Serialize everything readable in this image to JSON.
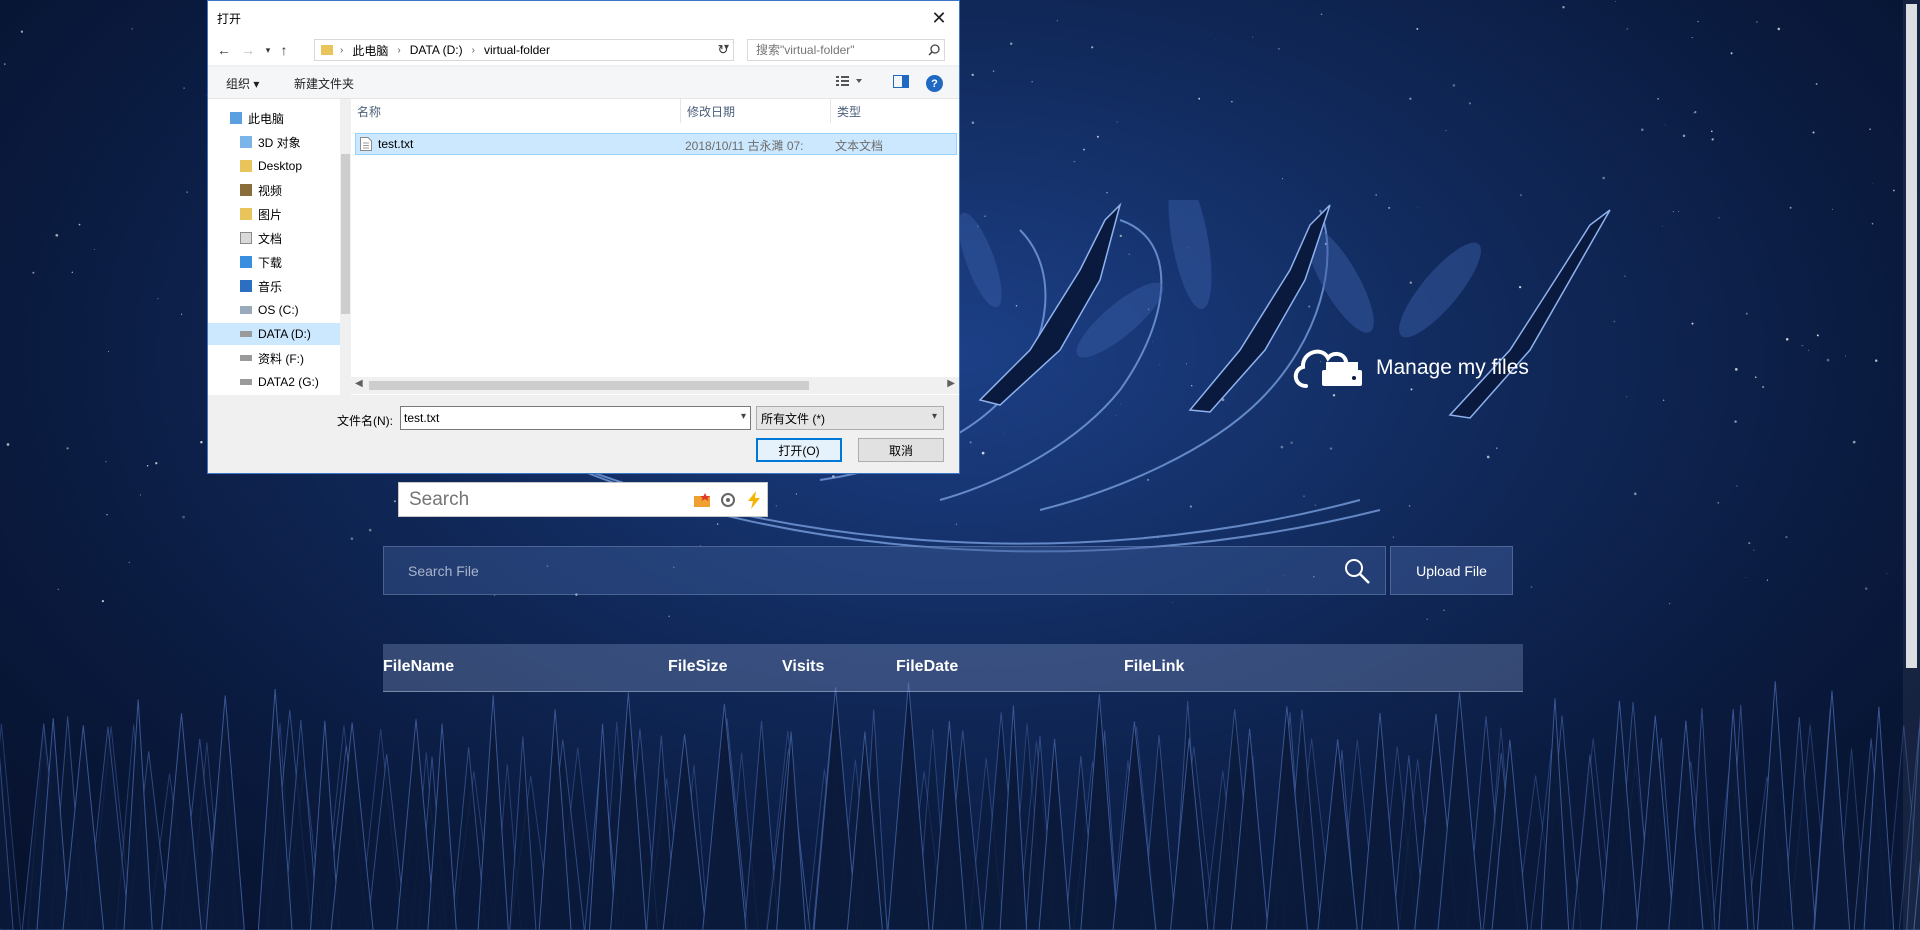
{
  "dialog": {
    "title": "打开",
    "close_glyph": "✕",
    "address": {
      "segments": [
        "此电脑",
        "DATA (D:)",
        "virtual-folder"
      ]
    },
    "search_placeholder": "搜索\"virtual-folder\"",
    "toolbar": {
      "organize": "组织 ▾",
      "new_folder": "新建文件夹",
      "help": "?"
    },
    "nav": {
      "items": [
        {
          "label": "此电脑",
          "icon": "computer-icon"
        },
        {
          "label": "3D 对象",
          "icon": "3d-objects-icon"
        },
        {
          "label": "Desktop",
          "icon": "desktop-folder-icon"
        },
        {
          "label": "视频",
          "icon": "videos-icon"
        },
        {
          "label": "图片",
          "icon": "pictures-icon"
        },
        {
          "label": "文档",
          "icon": "documents-icon"
        },
        {
          "label": "下载",
          "icon": "downloads-icon"
        },
        {
          "label": "音乐",
          "icon": "music-icon"
        },
        {
          "label": "OS (C:)",
          "icon": "os-drive-icon"
        },
        {
          "label": "DATA (D:)",
          "icon": "drive-icon"
        },
        {
          "label": "资料 (F:)",
          "icon": "drive-icon"
        },
        {
          "label": "DATA2 (G:)",
          "icon": "drive-icon"
        }
      ],
      "selected_index": 9
    },
    "columns": [
      "名称",
      "修改日期",
      "类型"
    ],
    "files": [
      {
        "name": "test.txt",
        "modified": "2018/10/11 古永濉 07:",
        "type": "文本文档"
      }
    ],
    "filename_label": "文件名(N):",
    "filename_value": "test.txt",
    "filetype_value": "所有文件 (*)",
    "open_button": "打开(O)",
    "cancel_button": "取消"
  },
  "page": {
    "manage_label": "Manage my files",
    "mini_search_placeholder": "Search",
    "search_file_placeholder": "Search File",
    "upload_button": "Upload File",
    "table_headers": [
      "FileName",
      "FileSize",
      "Visits",
      "FileDate",
      "FileLink"
    ]
  },
  "colors": {
    "accent": "#0078d7",
    "selection": "#cce8ff",
    "sky_dark": "#061029",
    "sky_light": "#1c3f86"
  }
}
